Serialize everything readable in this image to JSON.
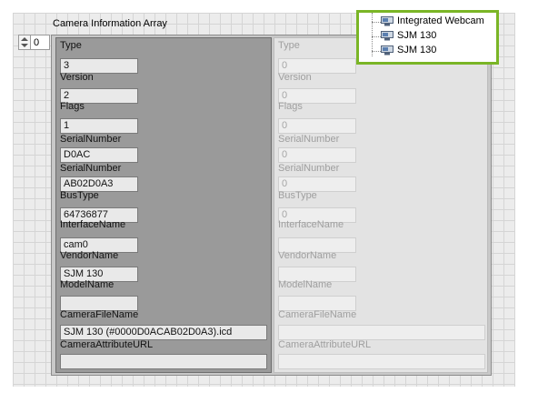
{
  "control": {
    "title": "Camera Information Array",
    "index_value": "0"
  },
  "device_list": {
    "items": [
      {
        "label": "Integrated Webcam",
        "icon": "camera-icon"
      },
      {
        "label": "SJM 130",
        "icon": "camera-icon"
      },
      {
        "label": "SJM 130",
        "icon": "camera-icon"
      }
    ]
  },
  "active_element": {
    "type_label": "Type",
    "type_value": "3",
    "version_label": "Version",
    "version_value": "2",
    "flags_label": "Flags",
    "flags_value": "1",
    "serial_label": "SerialNumber",
    "serial_value": "D0AC",
    "serial2_label": "SerialNumber",
    "serial2_value": "AB02D0A3",
    "bustype_label": "BusType",
    "bustype_value": "64736877",
    "interface_label": "InterfaceName",
    "interface_value": "cam0",
    "vendor_label": "VendorName",
    "vendor_value": "SJM 130",
    "model_label": "ModelName",
    "model_value": "",
    "camfile_label": "CameraFileName",
    "camfile_value": "SJM 130  (#0000D0ACAB02D0A3).icd",
    "attrurl_label": "CameraAttributeURL",
    "attrurl_value": ""
  },
  "inactive_element": {
    "type_label": "Type",
    "type_value": "0",
    "version_label": "Version",
    "version_value": "0",
    "flags_label": "Flags",
    "flags_value": "0",
    "serial_label": "SerialNumber",
    "serial_value": "0",
    "serial2_label": "SerialNumber",
    "serial2_value": "0",
    "bustype_label": "BusType",
    "bustype_value": "0",
    "interface_label": "InterfaceName",
    "interface_value": "",
    "vendor_label": "VendorName",
    "vendor_value": "",
    "model_label": "ModelName",
    "model_value": "",
    "camfile_label": "CameraFileName",
    "camfile_value": "",
    "attrurl_label": "CameraAttributeURL",
    "attrurl_value": ""
  },
  "colors": {
    "popup_border": "#7ab526",
    "active_cluster": "#9a9a9a",
    "inactive_cluster": "#e3e3e3"
  }
}
